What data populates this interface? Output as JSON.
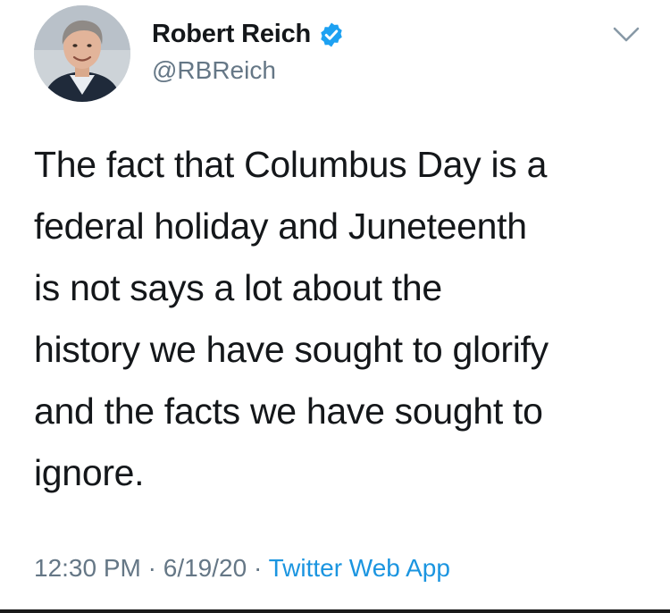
{
  "user": {
    "display_name": "Robert Reich",
    "handle": "@RBReich",
    "verified": true
  },
  "tweet": {
    "lines": [
      "The fact that Columbus Day is a",
      "federal holiday and Juneteenth",
      "is not says a lot about the",
      "history we have sought to glorify",
      "and the facts we have sought to",
      "ignore."
    ],
    "time": "12:30 PM",
    "date": "6/19/20",
    "separator": "·",
    "source": "Twitter Web App"
  },
  "icons": {
    "verified": "verified-badge-icon",
    "menu": "chevron-down-icon"
  },
  "colors": {
    "verified_blue": "#1da1f2",
    "link_blue": "#1b95e0",
    "secondary_text": "#657786",
    "primary_text": "#14171a"
  }
}
